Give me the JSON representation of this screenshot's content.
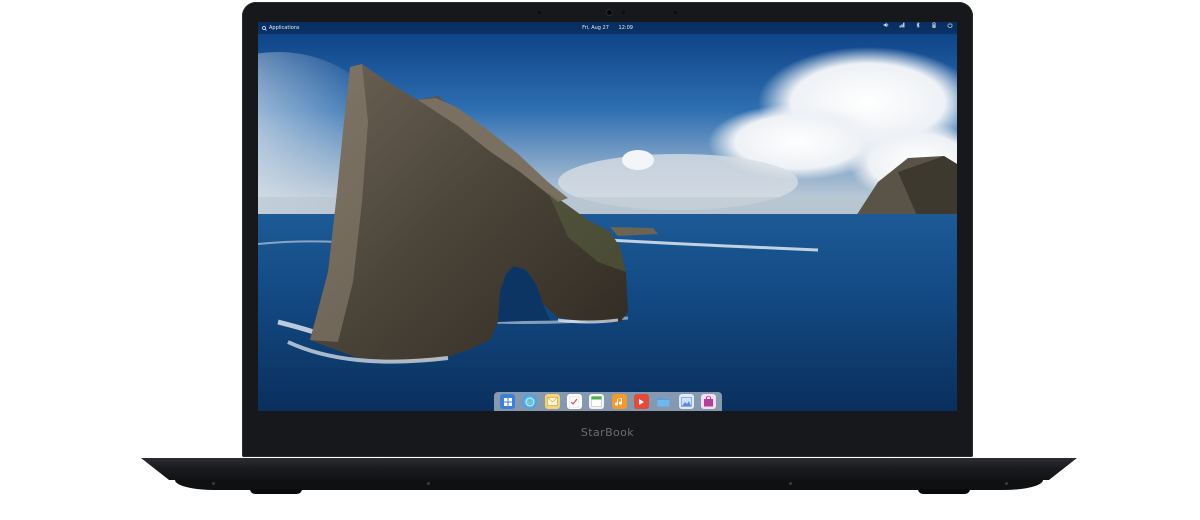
{
  "top_panel": {
    "applications_label": "Applications",
    "date": "Fri, Aug 27",
    "time": "12:09",
    "indicators": [
      "volume-icon",
      "network-icon",
      "bluetooth-icon",
      "battery-icon",
      "power-icon"
    ]
  },
  "dock": {
    "apps": [
      {
        "name": "multitasking-view",
        "color": "#3d7fd9"
      },
      {
        "name": "web-browser",
        "color": "#3aa4e8"
      },
      {
        "name": "mail",
        "color": "#f2c94c"
      },
      {
        "name": "tasks",
        "color": "#e84b5f"
      },
      {
        "name": "calendar",
        "color": "#ffffff"
      },
      {
        "name": "music",
        "color": "#f39a2b"
      },
      {
        "name": "videos",
        "color": "#e34a3a"
      },
      {
        "name": "files",
        "color": "#4aa3e6"
      },
      {
        "name": "photos",
        "color": "#5d8bd8"
      },
      {
        "name": "app-center",
        "color": "#b63f9a"
      }
    ]
  },
  "device": {
    "brand": "StarBook"
  },
  "colors": {
    "bezel": "#17181b",
    "sky_top": "#0b3f80",
    "sea": "#0f4a86"
  }
}
